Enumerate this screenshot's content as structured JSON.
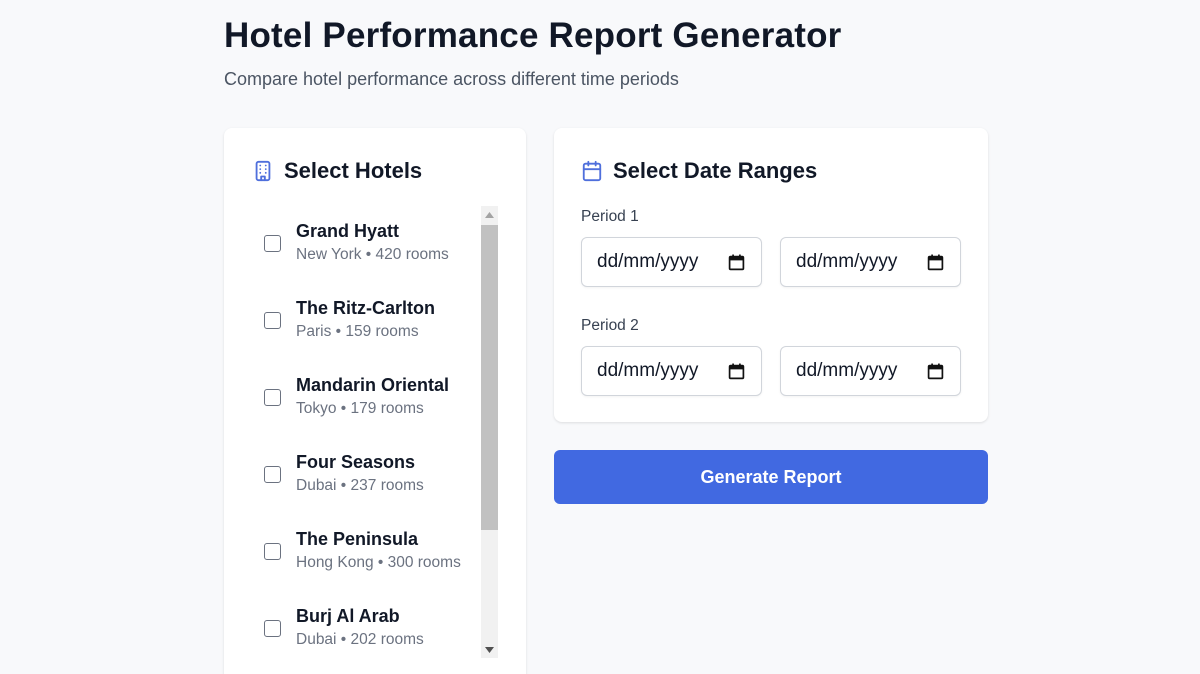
{
  "page": {
    "title": "Hotel Performance Report Generator",
    "subtitle": "Compare hotel performance across different time periods"
  },
  "hotels_card": {
    "title": "Select Hotels",
    "icon": "building-icon",
    "items": [
      {
        "name": "Grand Hyatt",
        "meta": "New York • 420 rooms",
        "checked": false
      },
      {
        "name": "The Ritz-Carlton",
        "meta": "Paris • 159 rooms",
        "checked": false
      },
      {
        "name": "Mandarin Oriental",
        "meta": "Tokyo • 179 rooms",
        "checked": false
      },
      {
        "name": "Four Seasons",
        "meta": "Dubai • 237 rooms",
        "checked": false
      },
      {
        "name": "The Peninsula",
        "meta": "Hong Kong • 300 rooms",
        "checked": false
      },
      {
        "name": "Burj Al Arab",
        "meta": "Dubai • 202 rooms",
        "checked": false
      }
    ]
  },
  "dates_card": {
    "title": "Select Date Ranges",
    "icon": "calendar-icon",
    "periods": [
      {
        "label": "Period 1",
        "start": "dd/mm/yyyy",
        "end": "dd/mm/yyyy"
      },
      {
        "label": "Period 2",
        "start": "dd/mm/yyyy",
        "end": "dd/mm/yyyy"
      }
    ]
  },
  "actions": {
    "generate_label": "Generate Report"
  },
  "colors": {
    "accent": "#4169e1",
    "icon_blue": "#4f6fdc",
    "background": "#f8f9fb"
  }
}
